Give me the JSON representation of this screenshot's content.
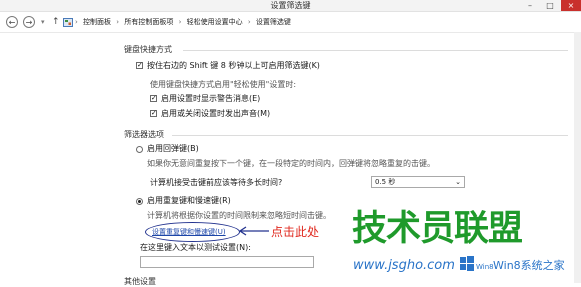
{
  "window": {
    "title": "设置筛选键",
    "minimize": "–",
    "restore": "□",
    "close": "×"
  },
  "nav": {
    "back": "←",
    "forward": "→",
    "up": "↑",
    "home_icon": "control-panel-icon"
  },
  "breadcrumbs": [
    "控制面板",
    "所有控制面板项",
    "轻松使用设置中心",
    "设置筛选键"
  ],
  "keyboard_shortcut": {
    "heading": "键盘快捷方式",
    "shift_option": "按住右边的 Shift 键 8 秒钟以上可启用筛选键(K)",
    "shift_checked": true,
    "hint": "使用键盘快捷方式启用\"轻松使用\"设置时:",
    "warn_option": "启用设置时显示警告消息(E)",
    "warn_checked": true,
    "sound_option": "启用或关闭设置时发出声音(M)",
    "sound_checked": true
  },
  "filter": {
    "heading": "筛选器选项",
    "bounce_option": "启用回弹键(B)",
    "bounce_selected": false,
    "bounce_desc": "如果你无意间重复按下一个键，在一段特定的时间内，回弹键将忽略重复的击键。",
    "wait_label": "计算机接受击键前应该等待多长时间?",
    "wait_value": "0.5 秒",
    "repeat_option": "启用重复键和慢速键(R)",
    "repeat_selected": true,
    "repeat_desc": "计算机将根据你设置的时间限制来忽略短时间击键。",
    "repeat_link": "设置重复键和慢速键(U)",
    "test_label": "在这里键入文本以测试设置(N):",
    "other_heading": "其他设置"
  },
  "annotation": {
    "text": "点击此处",
    "color": "#e0281e"
  },
  "watermark": {
    "title": "技术员联盟",
    "url": "www.jsgho.com",
    "brand": "Win8系统之家"
  }
}
